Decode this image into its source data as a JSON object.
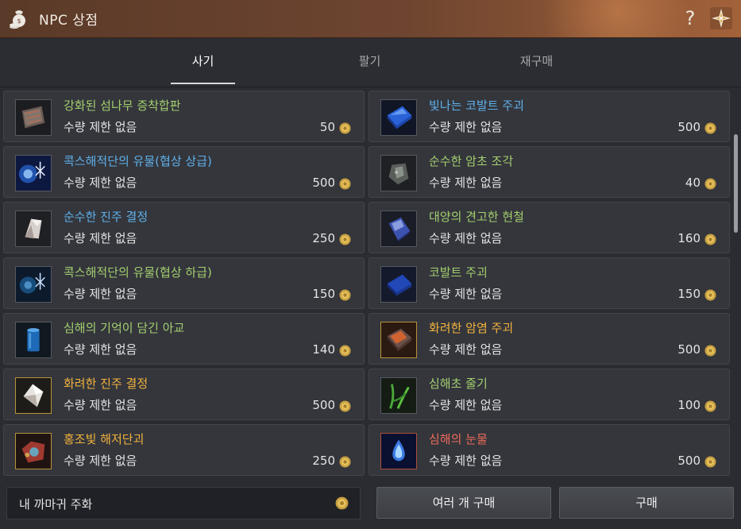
{
  "window": {
    "title": "NPC 상점",
    "help": "?"
  },
  "tabs": [
    {
      "label": "사기",
      "active": true
    },
    {
      "label": "팔기",
      "active": false
    },
    {
      "label": "재구매",
      "active": false
    }
  ],
  "items": [
    {
      "name": "강화된 섬나무 증착합판",
      "limit": "수량 제한 없음",
      "price": "50",
      "color": "green",
      "icon": "plywood-icon"
    },
    {
      "name": "빛나는 코발트 주괴",
      "limit": "수량 제한 없음",
      "price": "500",
      "color": "blue",
      "icon": "cobalt-ingot-icon"
    },
    {
      "name": "콕스해적단의 유물(협상 상급)",
      "limit": "수량 제한 없음",
      "price": "500",
      "color": "blue",
      "icon": "pirate-relic-icon"
    },
    {
      "name": "순수한 암초 조각",
      "limit": "수량 제한 없음",
      "price": "40",
      "color": "green",
      "icon": "reef-piece-icon"
    },
    {
      "name": "순수한 진주 결정",
      "limit": "수량 제한 없음",
      "price": "250",
      "color": "blue",
      "icon": "pearl-crystal-icon"
    },
    {
      "name": "대양의 견고한 현철",
      "limit": "수량 제한 없음",
      "price": "160",
      "color": "green",
      "icon": "ocean-iron-icon"
    },
    {
      "name": "콕스해적단의 유물(협상 하급)",
      "limit": "수량 제한 없음",
      "price": "150",
      "color": "green",
      "icon": "pirate-relic-icon"
    },
    {
      "name": "코발트 주괴",
      "limit": "수량 제한 없음",
      "price": "150",
      "color": "green",
      "icon": "cobalt-ingot-icon"
    },
    {
      "name": "심해의 기억이 담긴 아교",
      "limit": "수량 제한 없음",
      "price": "140",
      "color": "green",
      "icon": "glue-jar-icon"
    },
    {
      "name": "화려한 암염 주괴",
      "limit": "수량 제한 없음",
      "price": "500",
      "color": "gold",
      "icon": "rock-salt-ingot-icon"
    },
    {
      "name": "화려한 진주 결정",
      "limit": "수량 제한 없음",
      "price": "500",
      "color": "gold",
      "icon": "pearl-crystal-icon"
    },
    {
      "name": "심해초 줄기",
      "limit": "수량 제한 없음",
      "price": "100",
      "color": "green",
      "icon": "seaweed-stem-icon"
    },
    {
      "name": "홍조빛 해저단괴",
      "limit": "수량 제한 없음",
      "price": "250",
      "color": "gold",
      "icon": "red-nodule-icon"
    },
    {
      "name": "심해의 눈물",
      "limit": "수량 제한 없음",
      "price": "500",
      "color": "red",
      "icon": "sea-tear-icon"
    }
  ],
  "bottom": {
    "wallet_label": "내 까마귀 주화",
    "multi_buy": "여러 개 구매",
    "buy": "구매"
  },
  "colors": {
    "green": "#a4cf6e",
    "blue": "#5fb0ea",
    "gold": "#f2b23c",
    "red": "#ee6a58"
  }
}
